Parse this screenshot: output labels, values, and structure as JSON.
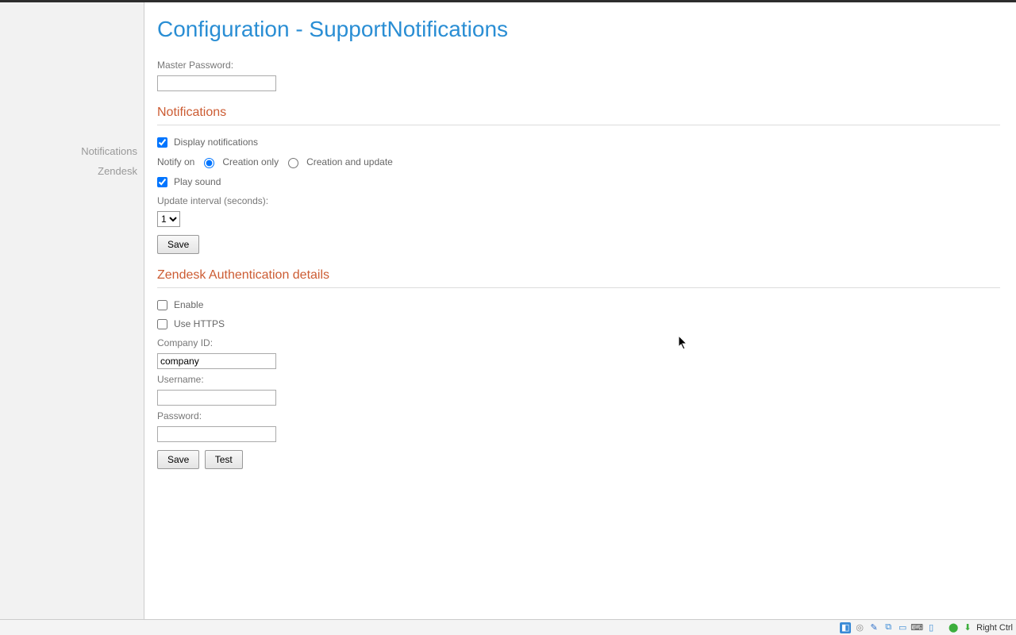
{
  "page": {
    "title": "Configuration - SupportNotifications"
  },
  "sidebar": {
    "items": [
      {
        "label": "Notifications"
      },
      {
        "label": "Zendesk"
      }
    ]
  },
  "master_password": {
    "label": "Master Password:",
    "value": ""
  },
  "notifications": {
    "section_title": "Notifications",
    "display_label": "Display notifications",
    "display_checked": true,
    "notify_on_label": "Notify on",
    "notify_options": {
      "creation_only": "Creation only",
      "creation_update": "Creation and update"
    },
    "notify_selected": "creation_only",
    "play_sound_label": "Play sound",
    "play_sound_checked": true,
    "interval_label": "Update interval (seconds):",
    "interval_value": "1",
    "save_label": "Save"
  },
  "zendesk": {
    "section_title": "Zendesk Authentication details",
    "enable_label": "Enable",
    "enable_checked": false,
    "https_label": "Use HTTPS",
    "https_checked": false,
    "company_label": "Company ID:",
    "company_value": "company",
    "username_label": "Username:",
    "username_value": "",
    "password_label": "Password:",
    "password_value": "",
    "save_label": "Save",
    "test_label": "Test"
  },
  "taskbar": {
    "right_ctrl": "Right Ctrl"
  }
}
